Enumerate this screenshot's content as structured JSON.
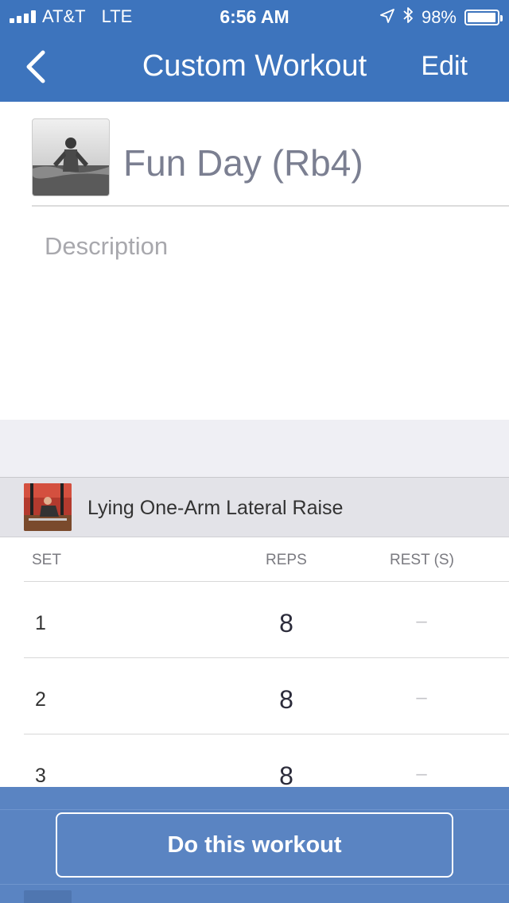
{
  "status_bar": {
    "carrier": "AT&T",
    "network": "LTE",
    "time": "6:56 AM",
    "battery_text": "98%",
    "battery_level": 0.98,
    "icons": [
      "signal-bars-icon",
      "location-arrow-icon",
      "bluetooth-icon",
      "battery-icon"
    ]
  },
  "nav": {
    "back_icon": "chevron-left-icon",
    "title": "Custom Workout",
    "edit_label": "Edit"
  },
  "workout": {
    "name": "Fun Day (Rb4)",
    "description_placeholder": "Description"
  },
  "exercise": {
    "name": "Lying One-Arm Lateral Raise"
  },
  "table": {
    "headers": {
      "set": "SET",
      "reps": "REPS",
      "rest": "REST (S)"
    },
    "rows": [
      {
        "set": "1",
        "reps": "8",
        "rest": "–"
      },
      {
        "set": "2",
        "reps": "8",
        "rest": "–"
      },
      {
        "set": "3",
        "reps": "8",
        "rest": "–"
      }
    ]
  },
  "cta": {
    "label": "Do this workout"
  },
  "colors": {
    "brand_blue": "#3d74bd",
    "bottom_bar": "#5a84c2",
    "title_gray": "#7b7f91",
    "section_gray": "#efeff4"
  }
}
